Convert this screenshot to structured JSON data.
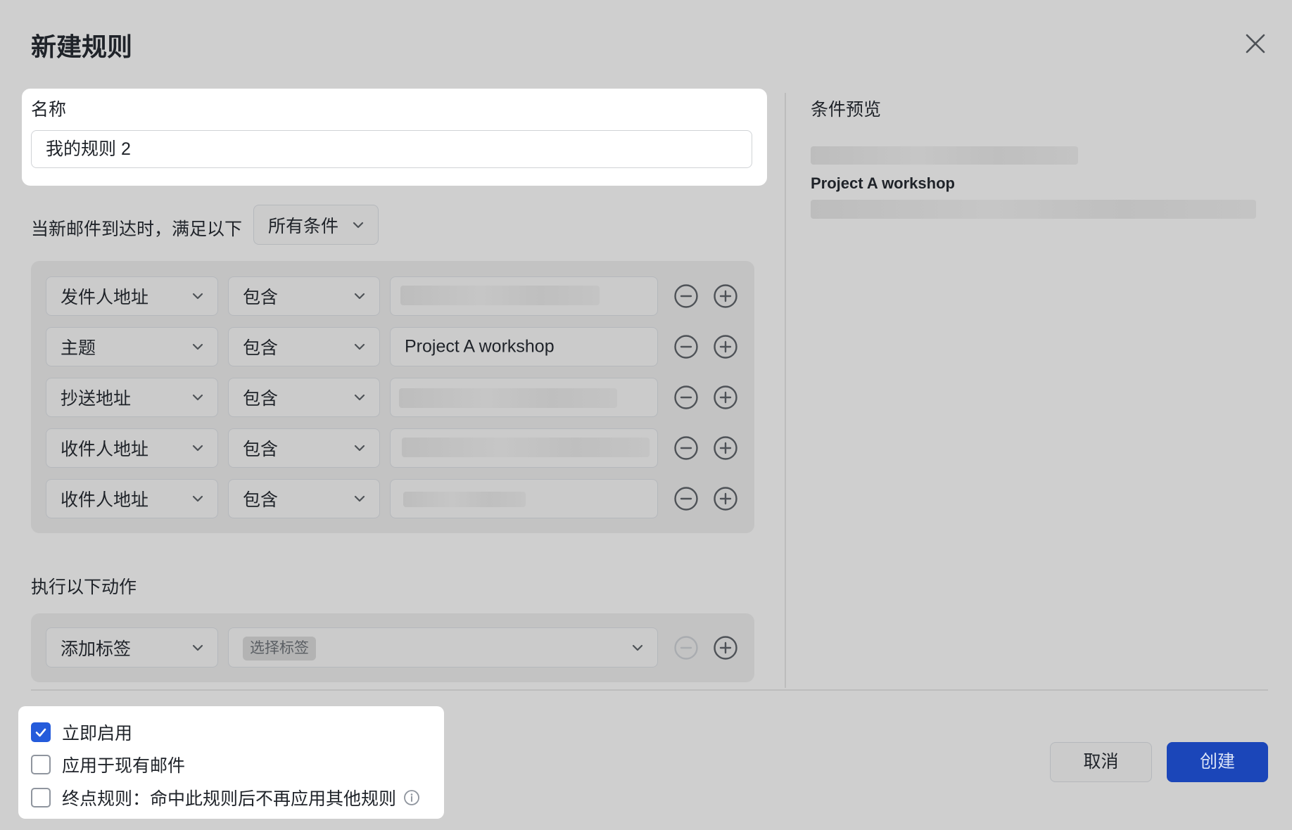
{
  "dialog": {
    "title": "新建规则",
    "close_icon": "close-icon"
  },
  "name_section": {
    "label": "名称",
    "value": "我的规则 2"
  },
  "condition_section": {
    "intro": "当新邮件到达时，满足以下",
    "match_mode": "所有条件",
    "rows": [
      {
        "field": "发件人地址",
        "operator": "包含",
        "value": ""
      },
      {
        "field": "主题",
        "operator": "包含",
        "value": "Project A workshop"
      },
      {
        "field": "抄送地址",
        "operator": "包含",
        "value": ""
      },
      {
        "field": "收件人地址",
        "operator": "包含",
        "value": ""
      },
      {
        "field": "收件人地址",
        "operator": "包含",
        "value": ""
      }
    ]
  },
  "action_section": {
    "title": "执行以下动作",
    "action": "添加标签",
    "tag_placeholder": "选择标签"
  },
  "preview": {
    "title": "条件预览",
    "subject": "Project A workshop"
  },
  "options": {
    "enable_now": {
      "label": "立即启用",
      "checked": true
    },
    "apply_existing": {
      "label": "应用于现有邮件",
      "checked": false
    },
    "terminal_rule": {
      "label": "终点规则：命中此规则后不再应用其他规则",
      "checked": false
    }
  },
  "buttons": {
    "cancel": "取消",
    "create": "创建"
  },
  "colors": {
    "primary": "#245bdb",
    "overlay": "#cfcfcf"
  }
}
